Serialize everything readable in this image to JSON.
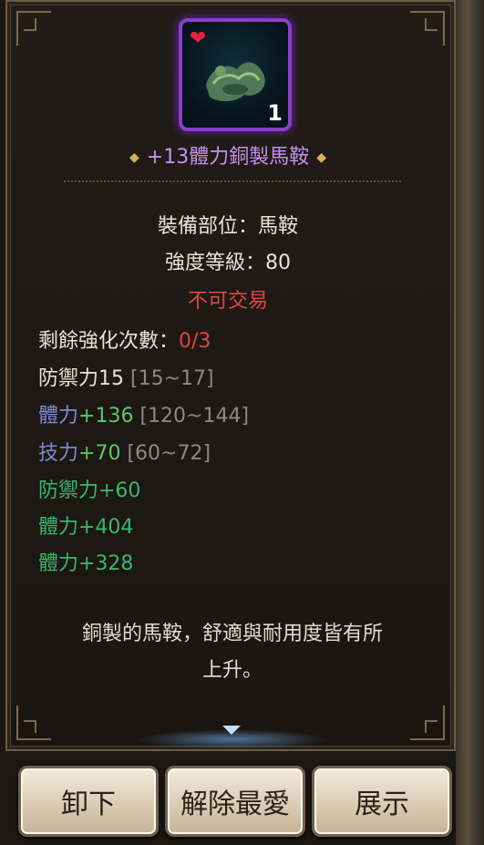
{
  "item": {
    "quantity": "1",
    "favorite_icon": "heart-icon",
    "name": "+13體力銅製馬鞍",
    "rarity_color": "#c58ff0",
    "slot_line": "裝備部位：馬鞍",
    "grade_line": "強度等級：80",
    "trade_status": "不可交易"
  },
  "stats": {
    "enhance_label": "剩餘強化次數：",
    "enhance_value": "0/3",
    "defense_label": "防禦力15",
    "defense_range": "[15~17]",
    "vit_label": "體力",
    "vit_value": "+136",
    "vit_range": "[120~144]",
    "skill_label": "技力",
    "skill_value": "+70",
    "skill_range": "[60~72]",
    "bonus": [
      "防禦力+60",
      "體力+404",
      "體力+328"
    ]
  },
  "description": [
    "銅製的馬鞍，舒適與耐用度皆有所",
    "上升。"
  ],
  "buttons": {
    "unequip": "卸下",
    "unfavorite": "解除最愛",
    "show": "展示"
  }
}
